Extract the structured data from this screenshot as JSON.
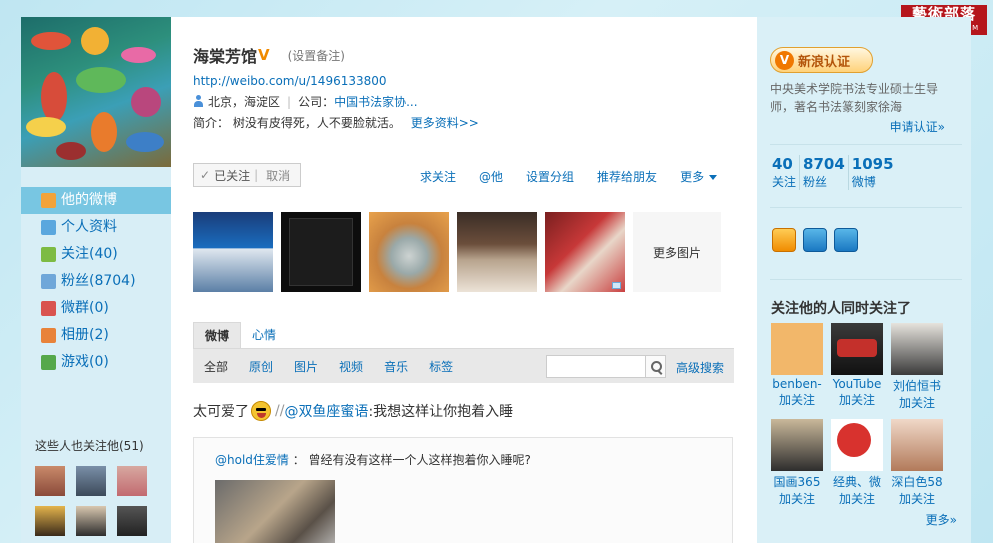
{
  "brand_logo": {
    "title": "藝術部落",
    "url": "WWW.XDSF.COM"
  },
  "left": {
    "nav": [
      {
        "label": "他的微博",
        "active": true
      },
      {
        "label": "个人资料"
      },
      {
        "label": "关注(40)"
      },
      {
        "label": "粉丝(8704)"
      },
      {
        "label": "微群(0)"
      },
      {
        "label": "相册(2)"
      },
      {
        "label": "游戏(0)"
      }
    ],
    "follow_title": "这些人也关注他(51)"
  },
  "profile": {
    "name": "海棠芳馆",
    "verified_mark": "V",
    "remark": "(设置备注)",
    "url": "http://weibo.com/u/1496133800",
    "location": "北京，海淀区",
    "company_label": "公司：",
    "company": "中国书法家协...",
    "bio_label": "简介：",
    "bio": "树没有皮得死，人不要脸就活。",
    "more_info": "更多资料>>"
  },
  "follow_box": {
    "check": "✓",
    "status": "已关注",
    "cancel": "取消"
  },
  "actions": {
    "ask_follow": "求关注",
    "at": "@他",
    "group": "设置分组",
    "recommend": "推荐给朋友",
    "more": "更多"
  },
  "photos": {
    "more": "更多图片"
  },
  "tabs": [
    {
      "label": "微博",
      "active": true
    },
    {
      "label": "心情"
    }
  ],
  "filters": [
    {
      "label": "全部",
      "active": true
    },
    {
      "label": "原创"
    },
    {
      "label": "图片"
    },
    {
      "label": "视频"
    },
    {
      "label": "音乐"
    },
    {
      "label": "标签"
    }
  ],
  "search": {
    "value": "",
    "adv": "高级搜索"
  },
  "post": {
    "text_before": "太可爱了",
    "repost_prefix": "//",
    "mention": "@双鱼座蜜语",
    "text_after": ":我想这样让你抱着入睡",
    "repost_author": "@hold住爱情",
    "repost_text": "：  曾经有没有这样一个人这样抱着你入睡呢?"
  },
  "right": {
    "auth_badge": "新浪认证",
    "auth_v": "V",
    "auth_desc": "中央美术学院书法专业硕士生导师，著名书法篆刻家徐海",
    "apply": "申请认证»",
    "stats": [
      {
        "num": "40",
        "label": "关注"
      },
      {
        "num": "8704",
        "label": "粉丝"
      },
      {
        "num": "1095",
        "label": "微博"
      }
    ],
    "rec_title": "关注他的人同时关注了",
    "recs": [
      {
        "name": "benben-",
        "follow": "加关注"
      },
      {
        "name": "YouTube",
        "follow": "加关注"
      },
      {
        "name": "刘伯恒书",
        "follow": "加关注"
      },
      {
        "name": "国画365",
        "follow": "加关注"
      },
      {
        "name": "经典、微",
        "follow": "加关注"
      },
      {
        "name": "深白色58",
        "follow": "加关注"
      }
    ],
    "more": "更多»"
  },
  "colors": {
    "link": "#0a6fb8",
    "nav_active": "#78c6e2",
    "verified": "#f08a00",
    "logo_bg": "#b5161c"
  }
}
